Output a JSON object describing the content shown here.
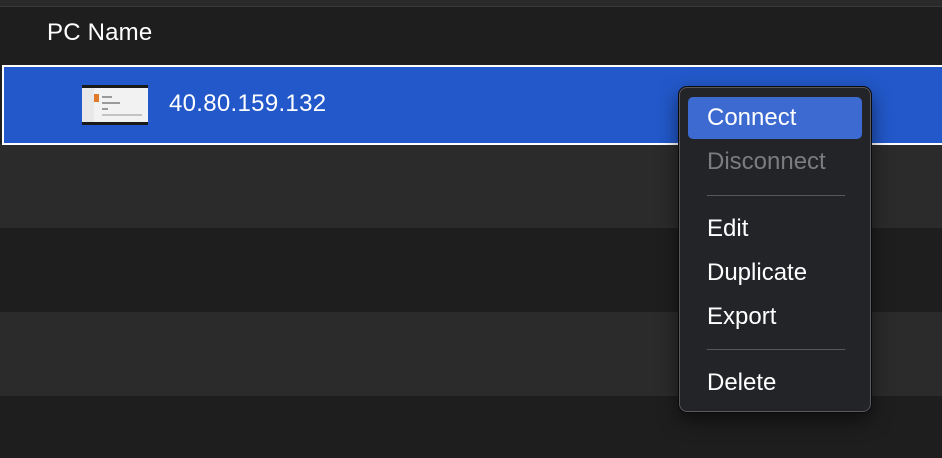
{
  "table": {
    "header": "PC Name",
    "rows": [
      {
        "name": "40.80.159.132",
        "selected": true,
        "thumbnail": "remote-desktop-thumbnail"
      }
    ]
  },
  "context_menu": {
    "items": [
      {
        "label": "Connect",
        "state": "highlighted"
      },
      {
        "label": "Disconnect",
        "state": "disabled"
      },
      {
        "label": "Edit",
        "state": "normal"
      },
      {
        "label": "Duplicate",
        "state": "normal"
      },
      {
        "label": "Export",
        "state": "normal"
      },
      {
        "label": "Delete",
        "state": "normal"
      }
    ]
  },
  "colors": {
    "selection": "#2258c9",
    "menu_highlight": "#3c6ad1",
    "background": "#1e1e1e",
    "alt_row": "#2b2b2b"
  }
}
